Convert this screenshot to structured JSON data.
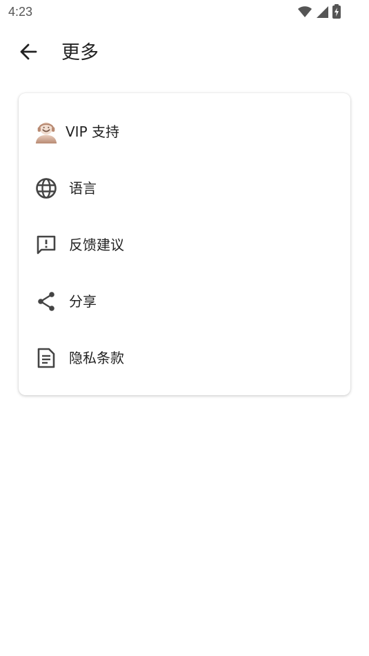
{
  "status_bar": {
    "time": "4:23",
    "icons": [
      "wifi-icon",
      "signal-icon",
      "battery-charging-icon"
    ]
  },
  "app_bar": {
    "back_icon": "arrow-left-icon",
    "title": "更多"
  },
  "menu": {
    "items": [
      {
        "icon": "vip-support-agent-icon",
        "label": "VIP 支持"
      },
      {
        "icon": "globe-icon",
        "label": "语言"
      },
      {
        "icon": "feedback-icon",
        "label": "反馈建议"
      },
      {
        "icon": "share-icon",
        "label": "分享"
      },
      {
        "icon": "document-icon",
        "label": "隐私条款"
      }
    ]
  },
  "colors": {
    "icon": "#444444",
    "text": "#222222",
    "vip_accent": "#c9a08c",
    "background": "#ffffff"
  }
}
